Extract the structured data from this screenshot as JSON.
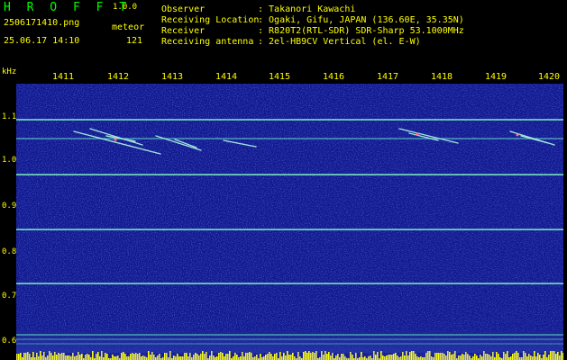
{
  "header": {
    "brand": "H R O F F T",
    "version": "1.0.0",
    "filename": "2506171410.png",
    "timestamp": "25.06.17 14:10",
    "meteor_label": "meteor",
    "meteor_count": "121"
  },
  "info": [
    {
      "label": "Observer",
      "value": ": Takanori Kawachi"
    },
    {
      "label": "Receiving Location",
      "value": ": Ogaki, Gifu, JAPAN (136.60E, 35.35N)"
    },
    {
      "label": "Receiver",
      "value": ": R820T2(RTL-SDR) SDR-Sharp 53.1000MHz"
    },
    {
      "label": "Receiving antenna",
      "value": ": 2el-HB9CV Vertical (el. E-W)"
    }
  ],
  "axes": {
    "y_unit": "kHz",
    "x_ticks": [
      "1411",
      "1412",
      "1413",
      "1414",
      "1415",
      "1416",
      "1417",
      "1418",
      "1419",
      "1420"
    ],
    "y_ticks": [
      "1.1",
      "1.0",
      "0.9",
      "0.8",
      "0.7",
      "0.6"
    ]
  },
  "colors": {
    "text_primary": "#ffff00",
    "text_secondary": "#00ff00",
    "background": "#000000",
    "spectrogram": "#10188c"
  }
}
